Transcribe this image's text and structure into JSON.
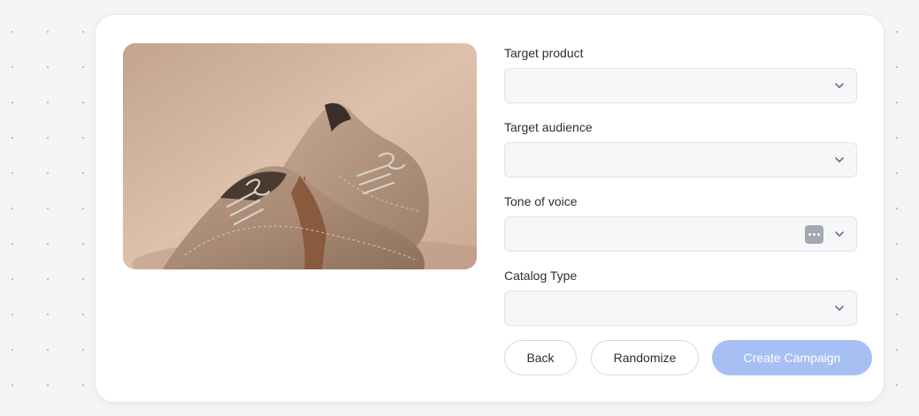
{
  "form": {
    "fields": [
      {
        "label": "Target product",
        "value": "",
        "icon": "chevron-down-icon"
      },
      {
        "label": "Target audience",
        "value": "",
        "icon": "chevron-down-icon"
      },
      {
        "label": "Tone of voice",
        "value": "",
        "icon": "chevron-down-icon",
        "extra_icon": "ellipsis-icon"
      },
      {
        "label": "Catalog Type",
        "value": "",
        "icon": "chevron-down-icon"
      }
    ]
  },
  "actions": {
    "back_label": "Back",
    "randomize_label": "Randomize",
    "create_label": "Create Campaign"
  },
  "colors": {
    "primary_disabled": "#a8bff4",
    "field_bg": "#f6f7f9",
    "card_bg": "#ffffff"
  }
}
